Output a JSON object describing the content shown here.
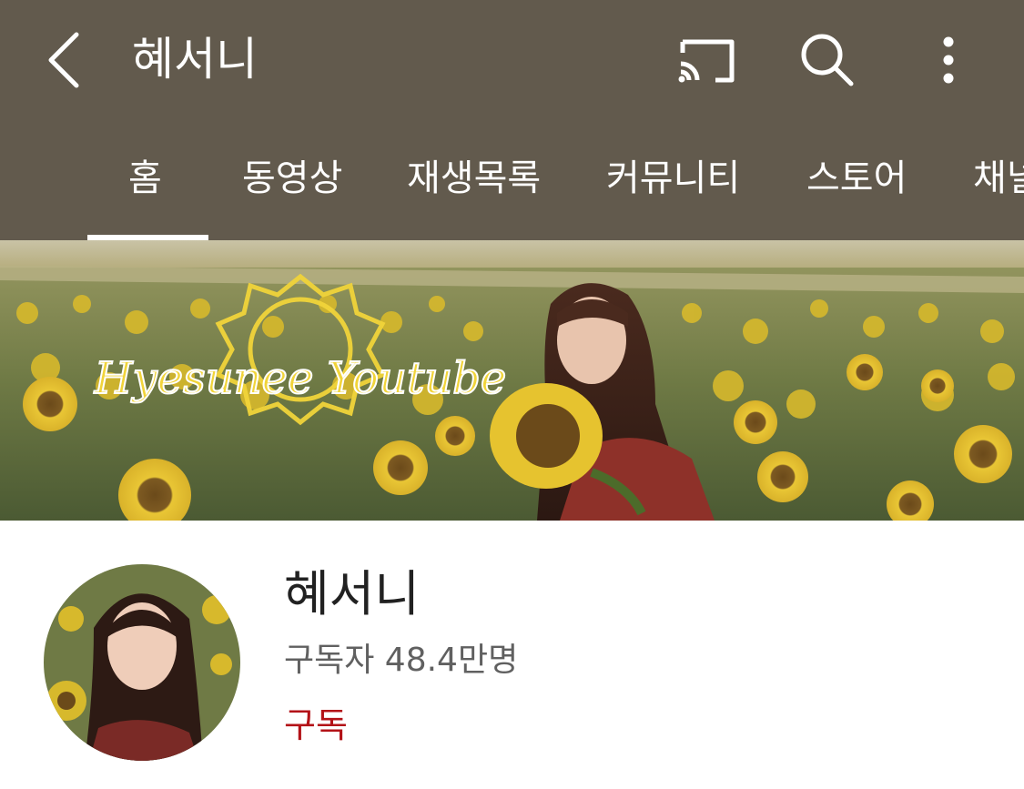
{
  "header": {
    "title": "혜서니",
    "icons": {
      "back": "chevron-left-icon",
      "cast": "cast-icon",
      "search": "search-icon",
      "more": "more-vert-icon"
    },
    "background_color": "#625a4d"
  },
  "tabs": [
    {
      "label": "홈",
      "selected": true
    },
    {
      "label": "동영상",
      "selected": false
    },
    {
      "label": "재생목록",
      "selected": false
    },
    {
      "label": "커뮤니티",
      "selected": false
    },
    {
      "label": "스토어",
      "selected": false
    },
    {
      "label": "채널",
      "selected": false
    }
  ],
  "banner": {
    "logo_text": "Hyesunee Youtube"
  },
  "channel": {
    "name": "혜서니",
    "subscribers": "구독자 48.4만명",
    "subscribe_label": "구독",
    "subscribe_color": "#b31217"
  }
}
